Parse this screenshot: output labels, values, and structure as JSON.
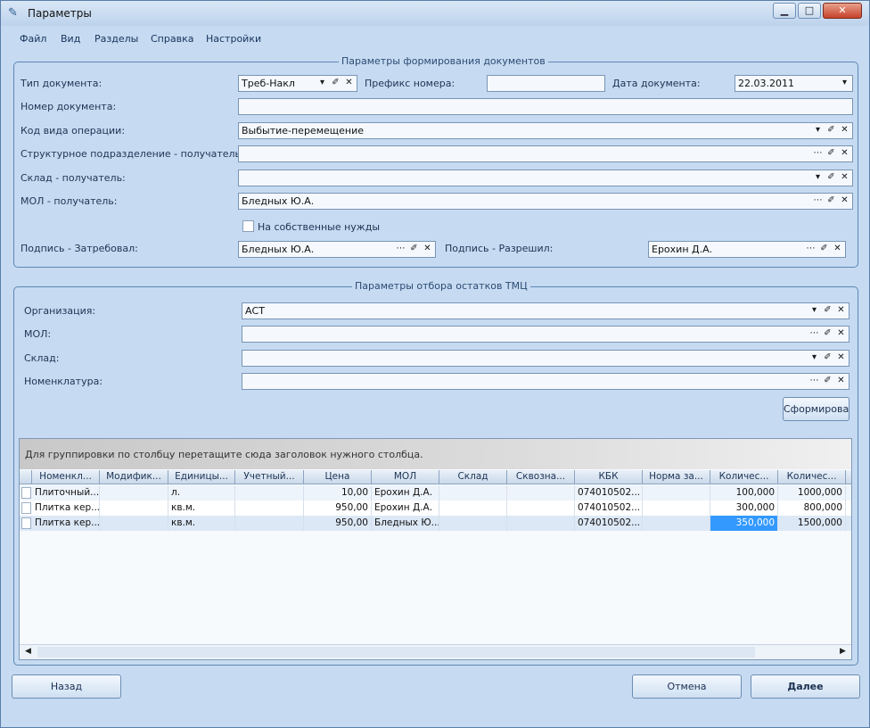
{
  "window": {
    "title": "Параметры"
  },
  "menu": [
    "Файл",
    "Вид",
    "Разделы",
    "Справка",
    "Настройки"
  ],
  "doc_group": {
    "title": "Параметры формирования документов",
    "doc_type_label": "Тип документа:",
    "doc_type_value": "Треб-Накл",
    "prefix_label": "Префикс номера:",
    "prefix_value": "",
    "date_label": "Дата документа:",
    "date_value": "22.03.2011",
    "number_label": "Номер документа:",
    "number_value": "",
    "op_code_label": "Код вида операции:",
    "op_code_value": "Выбытие-перемещение",
    "dept_label": "Структурное подразделение -  получатель:",
    "dept_value": "",
    "warehouse_label": "Склад -  получатель:",
    "warehouse_value": "",
    "mol_label": "МОЛ -  получатель:",
    "mol_value": "Бледных Ю.А.",
    "own_needs_label": "На собственные нужды",
    "requested_label": "Подпись - Затребовал:",
    "requested_value": "Бледных Ю.А.",
    "allowed_label": "Подпись - Разрешил:",
    "allowed_value": "Ерохин Д.А."
  },
  "stock_group": {
    "title": "Параметры отбора остатков ТМЦ",
    "org_label": "Организация:",
    "org_value": "АСТ",
    "mol_label": "МОЛ:",
    "mol_value": "",
    "warehouse_label": "Склад:",
    "warehouse_value": "",
    "nomenclature_label": "Номенклатура:",
    "nomenclature_value": "",
    "form_button": "Сформировать"
  },
  "grid": {
    "group_hint": "Для группировки по столбцу перетащите сюда заголовок нужного столбца.",
    "columns": [
      "Номенкл...",
      "Модифик...",
      "Единицы...",
      "Учетный...",
      "Цена",
      "МОЛ",
      "Склад",
      "Сквозна...",
      "КБК",
      "Норма за...",
      "Количес...",
      "Количес..."
    ],
    "rows": [
      [
        "Плиточный...",
        "",
        "л.",
        "",
        "10,00",
        "Ерохин Д.А.",
        "",
        "",
        "074010502...",
        "",
        "100,000",
        "1000,000"
      ],
      [
        "Плитка кер...",
        "",
        "кв.м.",
        "",
        "950,00",
        "Ерохин Д.А.",
        "",
        "",
        "074010502...",
        "",
        "300,000",
        "800,000"
      ],
      [
        "Плитка кер...",
        "",
        "кв.м.",
        "",
        "950,00",
        "Бледных Ю...",
        "",
        "",
        "074010502...",
        "",
        "350,000",
        "1500,000"
      ]
    ]
  },
  "footer": {
    "back": "Назад",
    "cancel": "Отмена",
    "next": "Далее"
  },
  "colors": {
    "accent": "#3399ff",
    "window_bg": "#c6dbf1"
  }
}
